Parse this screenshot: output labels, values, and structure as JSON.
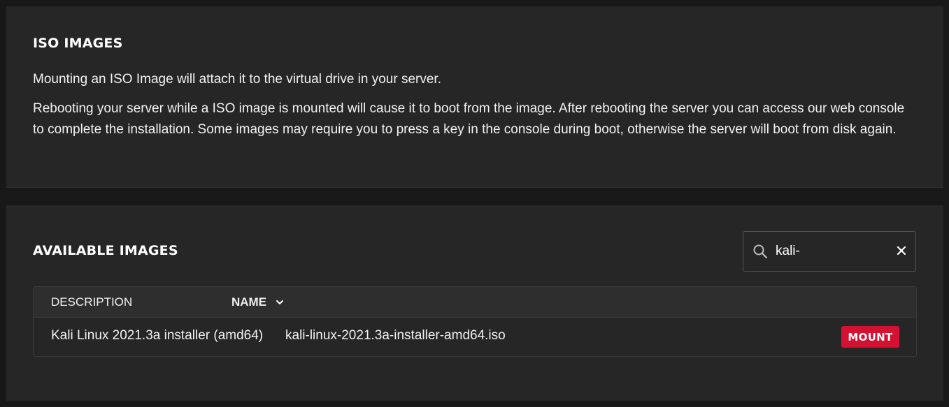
{
  "iso_section": {
    "title": "ISO IMAGES",
    "paragraph_1": "Mounting an ISO Image will attach it to the virtual drive in your server.",
    "paragraph_2": "Rebooting your server while a ISO image is mounted will cause it to boot from the image. After rebooting the server you can access our web console to complete the installation. Some images may require you to press a key in the console during boot, otherwise the server will boot from disk again."
  },
  "available_section": {
    "title": "AVAILABLE IMAGES",
    "search": {
      "value": "kali-",
      "icon": "search-icon",
      "clear_icon": "close-icon"
    },
    "table": {
      "columns": [
        "DESCRIPTION",
        "NAME"
      ],
      "sort_icon": "chevron-down-icon",
      "rows": [
        {
          "description": "Kali Linux 2021.3a installer (amd64)",
          "name": "kali-linux-2021.3a-installer-amd64.iso",
          "action_label": "MOUNT"
        }
      ]
    }
  },
  "colors": {
    "background": "#181818",
    "panel": "#262626",
    "accent": "#d41132"
  }
}
